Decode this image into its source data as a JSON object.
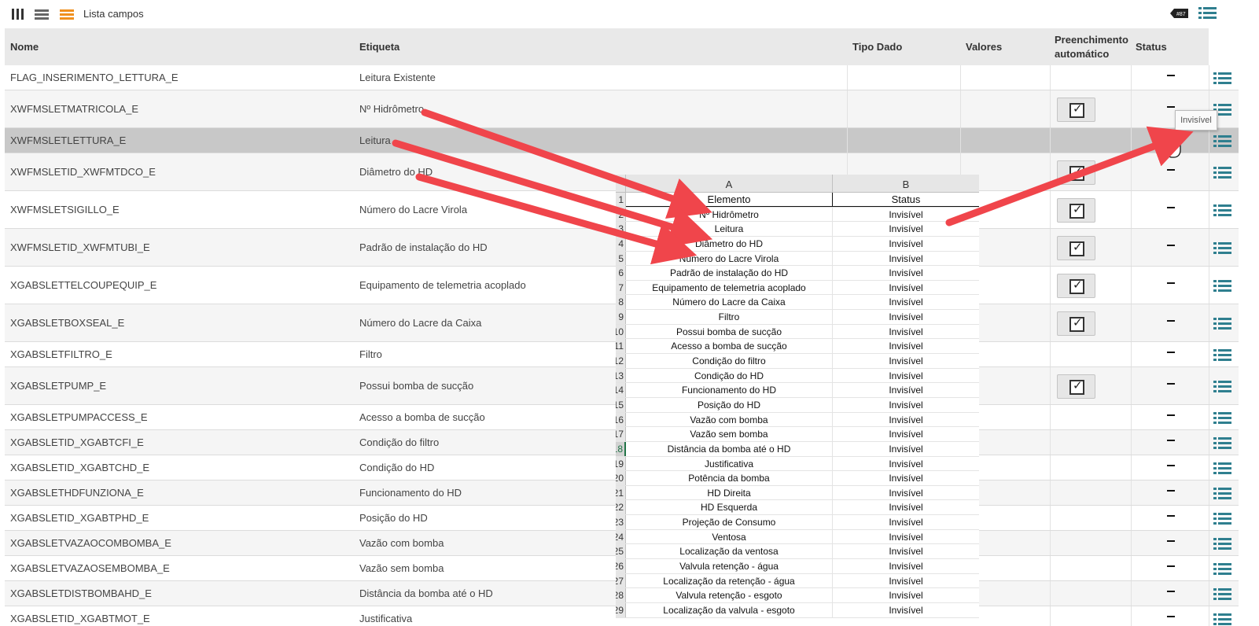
{
  "toolbar": {
    "title": "Lista campos",
    "icons": [
      "columns-icon",
      "list-icon",
      "detail-list-icon",
      "tag-icon",
      "menu-icon"
    ]
  },
  "grid": {
    "headers": {
      "nome": "Nome",
      "etiqueta": "Etiqueta",
      "tipo": "Tipo Dado",
      "valores": "Valores",
      "preench": "Preenchimento automático",
      "status": "Status"
    },
    "rows": [
      {
        "nome": "FLAG_INSERIMENTO_LETTURA_E",
        "etiqueta": "Leitura Existente",
        "auto": false
      },
      {
        "nome": "XWFMSLETMATRICOLA_E",
        "etiqueta": "Nº Hidrômetro",
        "auto": true
      },
      {
        "nome": "XWFMSLETLETTURA_E",
        "etiqueta": "Leitura",
        "auto": false,
        "selected": true
      },
      {
        "nome": "XWFMSLETID_XWFMTDCO_E",
        "etiqueta": "Diâmetro do HD",
        "auto": true
      },
      {
        "nome": "XWFMSLETSIGILLO_E",
        "etiqueta": "Número do Lacre Virola",
        "auto": true
      },
      {
        "nome": "XWFMSLETID_XWFMTUBI_E",
        "etiqueta": "Padrão de instalação do HD",
        "auto": true
      },
      {
        "nome": "XGABSLETTELCOUPEQUIP_E",
        "etiqueta": "Equipamento de telemetria acoplado",
        "auto": true
      },
      {
        "nome": "XGABSLETBOXSEAL_E",
        "etiqueta": "Número do Lacre da Caixa",
        "auto": true
      },
      {
        "nome": "XGABSLETFILTRO_E",
        "etiqueta": "Filtro",
        "auto": false
      },
      {
        "nome": "XGABSLETPUMP_E",
        "etiqueta": "Possui bomba de sucção",
        "auto": true
      },
      {
        "nome": "XGABSLETPUMPACCESS_E",
        "etiqueta": "Acesso a bomba de sucção",
        "auto": false
      },
      {
        "nome": "XGABSLETID_XGABTCFI_E",
        "etiqueta": "Condição do filtro",
        "auto": false
      },
      {
        "nome": "XGABSLETID_XGABTCHD_E",
        "etiqueta": "Condição do HD",
        "auto": false
      },
      {
        "nome": "XGABSLETHDFUNZIONA_E",
        "etiqueta": "Funcionamento do HD",
        "auto": false
      },
      {
        "nome": "XGABSLETID_XGABTPHD_E",
        "etiqueta": "Posição do HD",
        "auto": false
      },
      {
        "nome": "XGABSLETVAZAOCOMBOMBA_E",
        "etiqueta": "Vazão com bomba",
        "auto": false
      },
      {
        "nome": "XGABSLETVAZAOSEMBOMBA_E",
        "etiqueta": "Vazão sem bomba",
        "auto": false
      },
      {
        "nome": "XGABSLETDISTBOMBAHD_E",
        "etiqueta": "Distância da bomba até o HD",
        "auto": false
      },
      {
        "nome": "XGABSLETID_XGABTMOT_E",
        "etiqueta": "Justificativa",
        "auto": false
      }
    ]
  },
  "tooltip": "Invisível",
  "sheet": {
    "col_a": "A",
    "col_b": "B",
    "header": {
      "elemento": "Elemento",
      "status": "Status"
    },
    "active_row": "18",
    "rows": [
      {
        "n": "1",
        "a": "Elemento",
        "b": "Status"
      },
      {
        "n": "2",
        "a": "Nº Hidrômetro",
        "b": "Invisível"
      },
      {
        "n": "3",
        "a": "Leitura",
        "b": "Invisível"
      },
      {
        "n": "4",
        "a": "Diâmetro do HD",
        "b": "Invisível"
      },
      {
        "n": "5",
        "a": "Número do Lacre Virola",
        "b": "Invisível"
      },
      {
        "n": "6",
        "a": "Padrão de instalação do HD",
        "b": "Invisível"
      },
      {
        "n": "7",
        "a": "Equipamento de telemetria acoplado",
        "b": "Invisível"
      },
      {
        "n": "8",
        "a": "Número do Lacre da Caixa",
        "b": "Invisível"
      },
      {
        "n": "9",
        "a": "Filtro",
        "b": "Invisível"
      },
      {
        "n": "10",
        "a": "Possui bomba de sucção",
        "b": "Invisível"
      },
      {
        "n": "11",
        "a": "Acesso a bomba de sucção",
        "b": "Invisível"
      },
      {
        "n": "12",
        "a": "Condição do filtro",
        "b": "Invisível"
      },
      {
        "n": "13",
        "a": "Condição do HD",
        "b": "Invisível"
      },
      {
        "n": "14",
        "a": "Funcionamento do HD",
        "b": "Invisível"
      },
      {
        "n": "15",
        "a": "Posição do HD",
        "b": "Invisível"
      },
      {
        "n": "16",
        "a": "Vazão com bomba",
        "b": "Invisível"
      },
      {
        "n": "17",
        "a": "Vazão sem bomba",
        "b": "Invisível"
      },
      {
        "n": "18",
        "a": "Distância da bomba até o HD",
        "b": "Invisível"
      },
      {
        "n": "19",
        "a": "Justificativa",
        "b": "Invisível"
      },
      {
        "n": "20",
        "a": "Potência da bomba",
        "b": "Invisível"
      },
      {
        "n": "21",
        "a": "HD Direita",
        "b": "Invisível"
      },
      {
        "n": "22",
        "a": "HD Esquerda",
        "b": "Invisível"
      },
      {
        "n": "23",
        "a": "Projeção de Consumo",
        "b": "Invisível"
      },
      {
        "n": "24",
        "a": "Ventosa",
        "b": "Invisível"
      },
      {
        "n": "25",
        "a": "Localização da ventosa",
        "b": "Invisível"
      },
      {
        "n": "26",
        "a": "Valvula retenção - água",
        "b": "Invisível"
      },
      {
        "n": "27",
        "a": "Localização da retenção - água",
        "b": "Invisível"
      },
      {
        "n": "28",
        "a": "Valvula retenção - esgoto",
        "b": "Invisível"
      },
      {
        "n": "29",
        "a": "Localização da valvula - esgoto",
        "b": "Invisível"
      }
    ]
  },
  "colors": {
    "accent_orange": "#f0901e",
    "menu_icon_teal": "#2f7f8f",
    "arrow_red": "#f0454b",
    "header_bg": "#e9e9e9",
    "selected_row": "#c8c8c8",
    "excel_green": "#217346"
  }
}
